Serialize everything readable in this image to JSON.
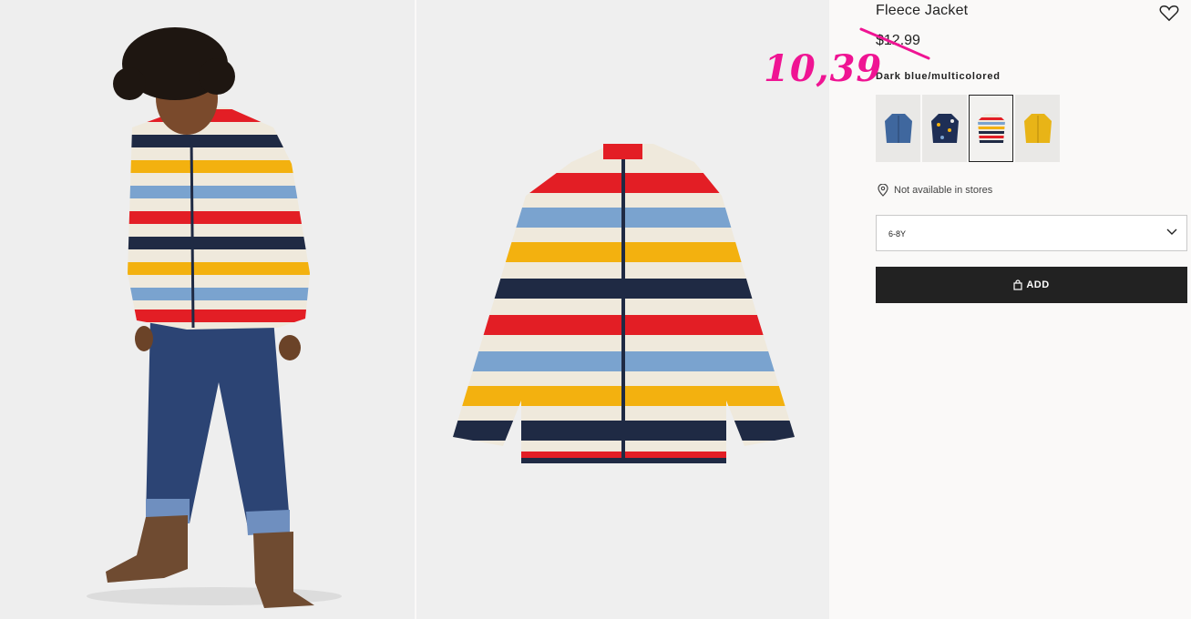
{
  "product": {
    "title": "Fleece Jacket",
    "old_price": "$12.99",
    "new_price": "10,39",
    "color_name": "Dark blue/multicolored",
    "availability": "Not available in stores",
    "size_selected": "6-8Y",
    "add_label": "ADD"
  },
  "swatches": [
    {
      "name": "denim blue",
      "selected": false
    },
    {
      "name": "dark blue print",
      "selected": false
    },
    {
      "name": "dark blue/multicolored",
      "selected": true
    },
    {
      "name": "yellow",
      "selected": false
    }
  ],
  "colors": {
    "sale_price": "#ef1493",
    "button_bg": "#222222",
    "stripe_red": "#e31e25",
    "stripe_yellow": "#f3b10f",
    "stripe_blue": "#7aa3cf",
    "stripe_navy": "#1f2a44",
    "stripe_cream": "#efe9dc"
  },
  "icons": {
    "favorite": "heart-icon",
    "location": "location-pin-icon",
    "dropdown": "chevron-down-icon",
    "bag": "shopping-bag-icon"
  }
}
